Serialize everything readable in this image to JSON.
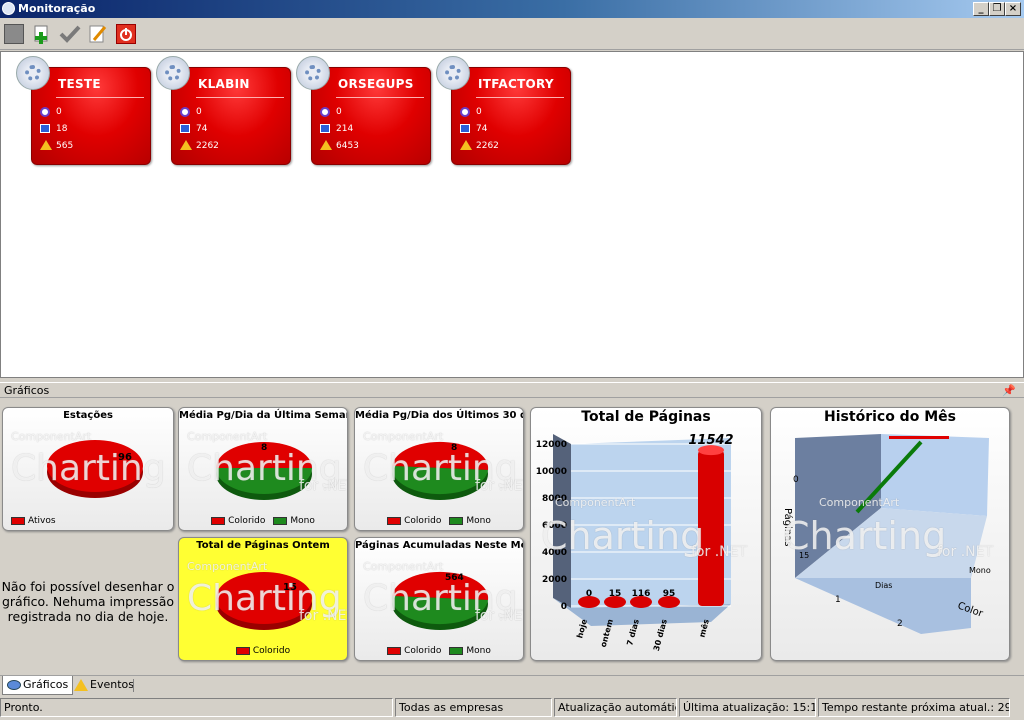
{
  "window": {
    "title": "Monitoração",
    "accent": "#0a246a"
  },
  "toolbar": {
    "buttons": [
      {
        "icon": "gray-box-icon"
      },
      {
        "icon": "add-icon"
      },
      {
        "icon": "check-icon"
      },
      {
        "icon": "edit-icon"
      },
      {
        "icon": "power-icon"
      }
    ]
  },
  "companies": [
    {
      "name": "TESTE",
      "offline": "0",
      "stations": "18",
      "alerts": "565"
    },
    {
      "name": "KLABIN",
      "offline": "0",
      "stations": "74",
      "alerts": "2262"
    },
    {
      "name": "ORSEGUPS",
      "offline": "0",
      "stations": "214",
      "alerts": "6453"
    },
    {
      "name": "ITFACTORY",
      "offline": "0",
      "stations": "74",
      "alerts": "2262"
    }
  ],
  "graficos": {
    "header": "Gráficos"
  },
  "watermark": {
    "brand": "ComponentArt",
    "main": "Charting",
    "suffix": "for .NET"
  },
  "legend": {
    "ativos": "Ativos",
    "colorido": "Colorido",
    "mono": "Mono"
  },
  "no_data_message": "Não foi possível desenhar o gráfico. Nehuma impressão registrada no dia de hoje.",
  "colors": {
    "red": "#e00000",
    "green": "#1e8a1e",
    "yellow": "#ffff33"
  },
  "chart_data": [
    {
      "type": "pie",
      "title": "Estações",
      "series": [
        {
          "name": "Ativos",
          "values": [
            96
          ]
        }
      ],
      "labels": [
        "96"
      ]
    },
    {
      "type": "pie",
      "title": "Média Pg/Dia da Última Semana",
      "categories": [
        "Colorido",
        "Mono"
      ],
      "values": [
        50,
        50
      ],
      "labels": [
        "8"
      ]
    },
    {
      "type": "pie",
      "title": "Média Pg/Dia dos Últimos 30 dias",
      "categories": [
        "Colorido",
        "Mono"
      ],
      "values": [
        55,
        45
      ],
      "labels": [
        "8"
      ]
    },
    {
      "type": "pie",
      "title": "Total de Páginas Ontem",
      "categories": [
        "Colorido"
      ],
      "values": [
        100
      ],
      "labels": [
        "15"
      ]
    },
    {
      "type": "pie",
      "title": "Páginas Acumuladas Neste Mês",
      "categories": [
        "Colorido",
        "Mono"
      ],
      "values": [
        55,
        45
      ],
      "labels": [
        "564"
      ]
    },
    {
      "type": "bar",
      "title": "Total de Páginas",
      "categories": [
        "hoje",
        "ontem",
        "7 dias",
        "30 dias",
        "mês"
      ],
      "values": [
        0,
        15,
        116,
        95,
        11542
      ],
      "value_labels": [
        "0",
        "15",
        "116",
        "95",
        "11542"
      ],
      "yticks": [
        "0",
        "2000",
        "4000",
        "6000",
        "8000",
        "10000",
        "12000"
      ],
      "ylim": [
        0,
        12000
      ]
    },
    {
      "type": "line",
      "title": "Histórico do Mês",
      "ylabel": "Páginas",
      "xlabel": "Dias",
      "zlabel": "Color",
      "axis_ticks": {
        "y": [
          "0",
          "15"
        ],
        "x": [
          "1",
          "2"
        ],
        "z": [
          "Mono"
        ]
      }
    }
  ],
  "tabs": [
    {
      "label": "Gráficos",
      "icon": "chart-icon",
      "active": true
    },
    {
      "label": "Eventos",
      "icon": "warning-icon",
      "active": false
    }
  ],
  "status": {
    "state": "Pronto.",
    "company_filter": "Todas as empresas",
    "update_mode": "Atualização automática",
    "last_update": "Última atualização: 15:12",
    "remaining": "Tempo restante próxima atual.: 29 min."
  }
}
